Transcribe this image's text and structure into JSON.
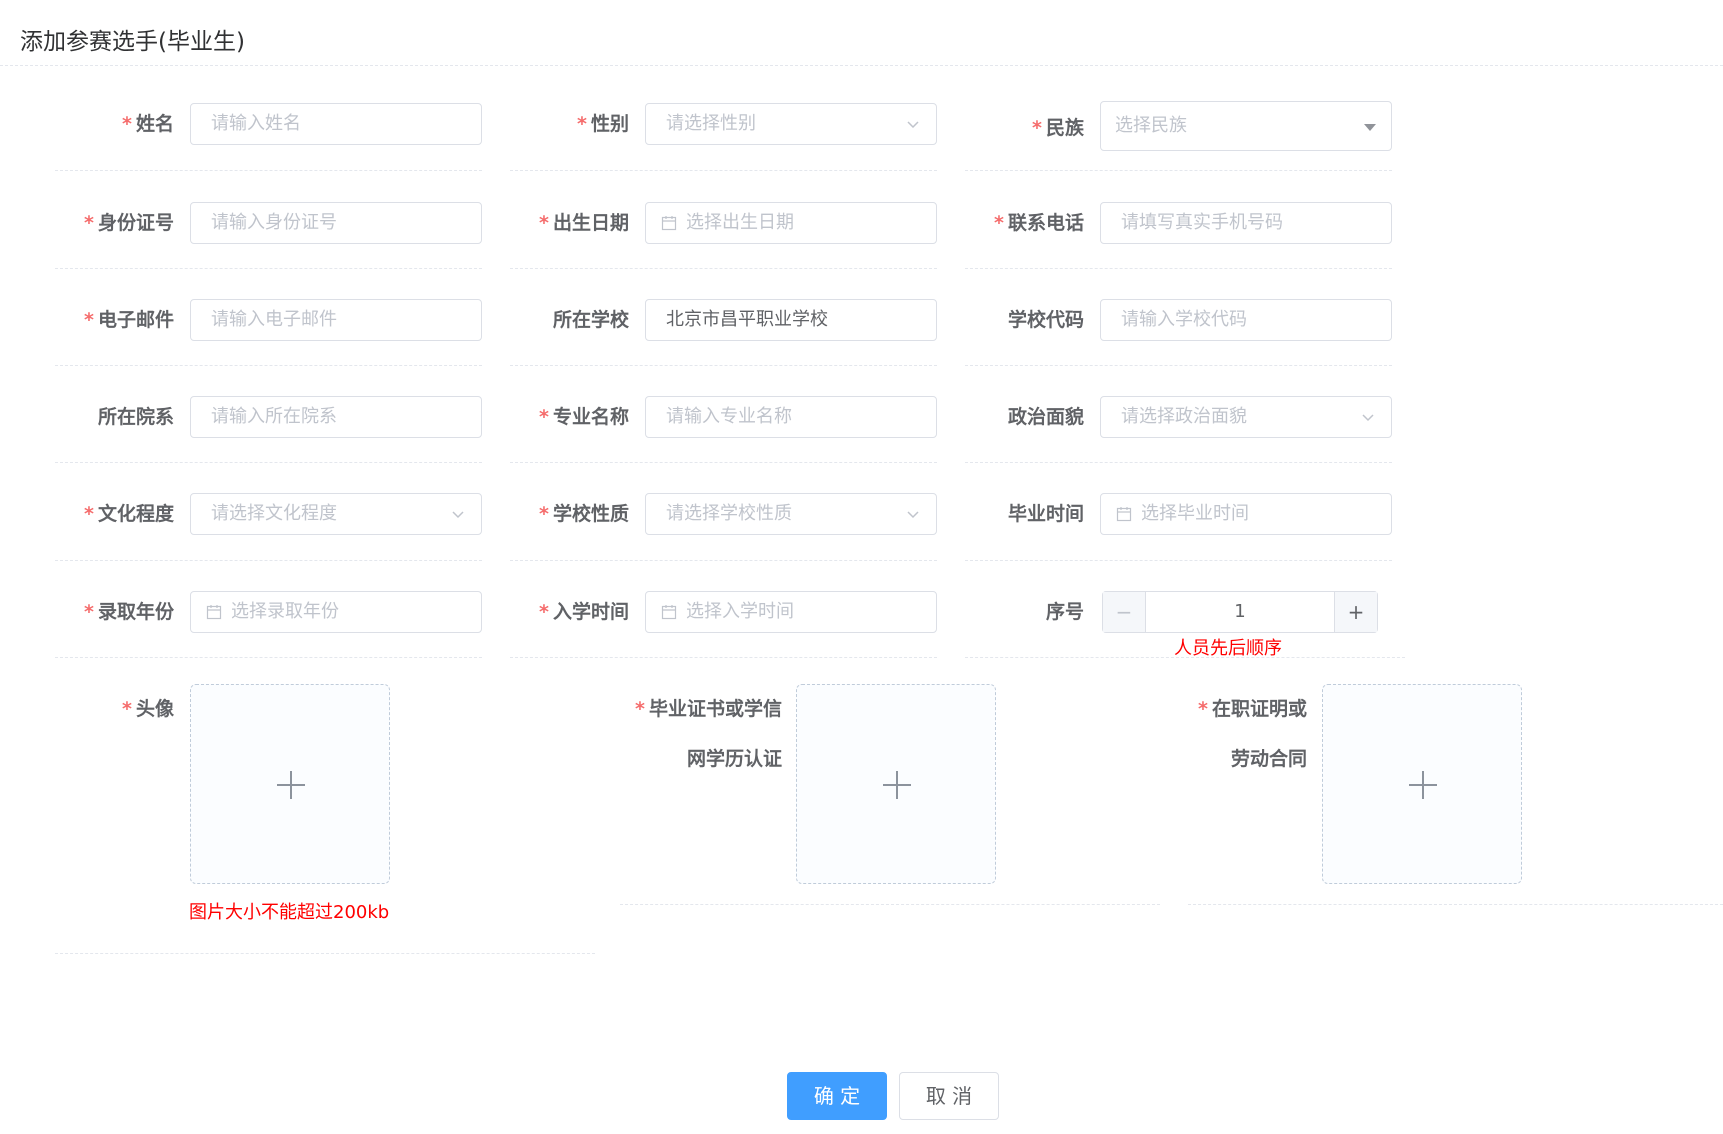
{
  "dialog": {
    "title": "添加参赛选手(毕业生)"
  },
  "form": {
    "name": {
      "label": "姓名",
      "required": "*",
      "placeholder": "请输入姓名"
    },
    "gender": {
      "label": "性别",
      "required": "*",
      "placeholder": "请选择性别"
    },
    "ethnicity": {
      "label": "民族",
      "required": "*",
      "placeholder": "选择民族"
    },
    "id_number": {
      "label": "身份证号",
      "required": "*",
      "placeholder": "请输入身份证号"
    },
    "birth_date": {
      "label": "出生日期",
      "required": "*",
      "placeholder": "选择出生日期"
    },
    "phone": {
      "label": "联系电话",
      "required": "*",
      "placeholder": "请填写真实手机号码"
    },
    "email": {
      "label": "电子邮件",
      "required": "*",
      "placeholder": "请输入电子邮件"
    },
    "school": {
      "label": "所在学校",
      "value": "北京市昌平职业学校"
    },
    "school_code": {
      "label": "学校代码",
      "placeholder": "请输入学校代码"
    },
    "department": {
      "label": "所在院系",
      "placeholder": "请输入所在院系"
    },
    "major": {
      "label": "专业名称",
      "required": "*",
      "placeholder": "请输入专业名称"
    },
    "political_status": {
      "label": "政治面貌",
      "placeholder": "请选择政治面貌"
    },
    "education": {
      "label": "文化程度",
      "required": "*",
      "placeholder": "请选择文化程度"
    },
    "school_type": {
      "label": "学校性质",
      "required": "*",
      "placeholder": "请选择学校性质"
    },
    "graduation_time": {
      "label": "毕业时间",
      "placeholder": "选择毕业时间"
    },
    "admission_year": {
      "label": "录取年份",
      "required": "*",
      "placeholder": "选择录取年份"
    },
    "enrollment_time": {
      "label": "入学时间",
      "required": "*",
      "placeholder": "选择入学时间"
    },
    "sequence": {
      "label": "序号",
      "value": "1",
      "hint": "人员先后顺序",
      "minus": "−",
      "plus": "+"
    },
    "avatar": {
      "label": "头像",
      "required": "*",
      "hint": "图片大小不能超过200kb"
    },
    "diploma": {
      "label_line1": "毕业证书或学信",
      "label_line2": "网学历认证",
      "required": "*"
    },
    "employment": {
      "label_line1": "在职证明或",
      "label_line2": "劳动合同",
      "required": "*"
    }
  },
  "footer": {
    "confirm_label": "确 定",
    "cancel_label": "取 消"
  },
  "icons": {
    "calendar": "calendar-icon",
    "chevron": "chevron-down-icon",
    "caret": "caret-down-icon",
    "plus": "plus-icon"
  },
  "colors": {
    "primary": "#409eff",
    "required": "#f56c6c",
    "hint": "#ff0000"
  }
}
